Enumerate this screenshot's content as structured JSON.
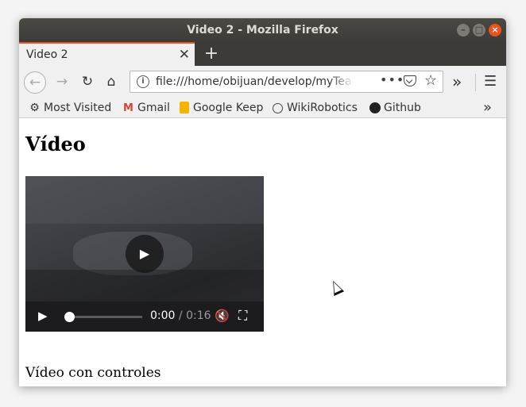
{
  "window": {
    "title": "Video 2 - Mozilla Firefox"
  },
  "tab": {
    "title": "Video 2",
    "close": "✕",
    "new_tab": "+"
  },
  "navbar": {
    "back": "←",
    "forward": "→",
    "reload": "↻",
    "home": "⌂",
    "url": "file:///home/obijuan/develop/myTeaching/",
    "page_actions": "•••",
    "bookmark_star": "☆",
    "overflow": "»",
    "menu": "☰"
  },
  "bookmarks": [
    {
      "label": "Most Visited",
      "icon": "gear-icon"
    },
    {
      "label": "Gmail",
      "icon": "gmail-icon"
    },
    {
      "label": "Google Keep",
      "icon": "keep-icon"
    },
    {
      "label": "WikiRobotics",
      "icon": "globe-icon"
    },
    {
      "label": "Github",
      "icon": "github-icon"
    }
  ],
  "bookmarks_overflow": "»",
  "page": {
    "heading": "Vídeo",
    "video": {
      "current_time": "0:00",
      "separator": " / ",
      "duration": "0:16",
      "progress": 0,
      "muted": true
    },
    "caption": "Vídeo con controles"
  }
}
